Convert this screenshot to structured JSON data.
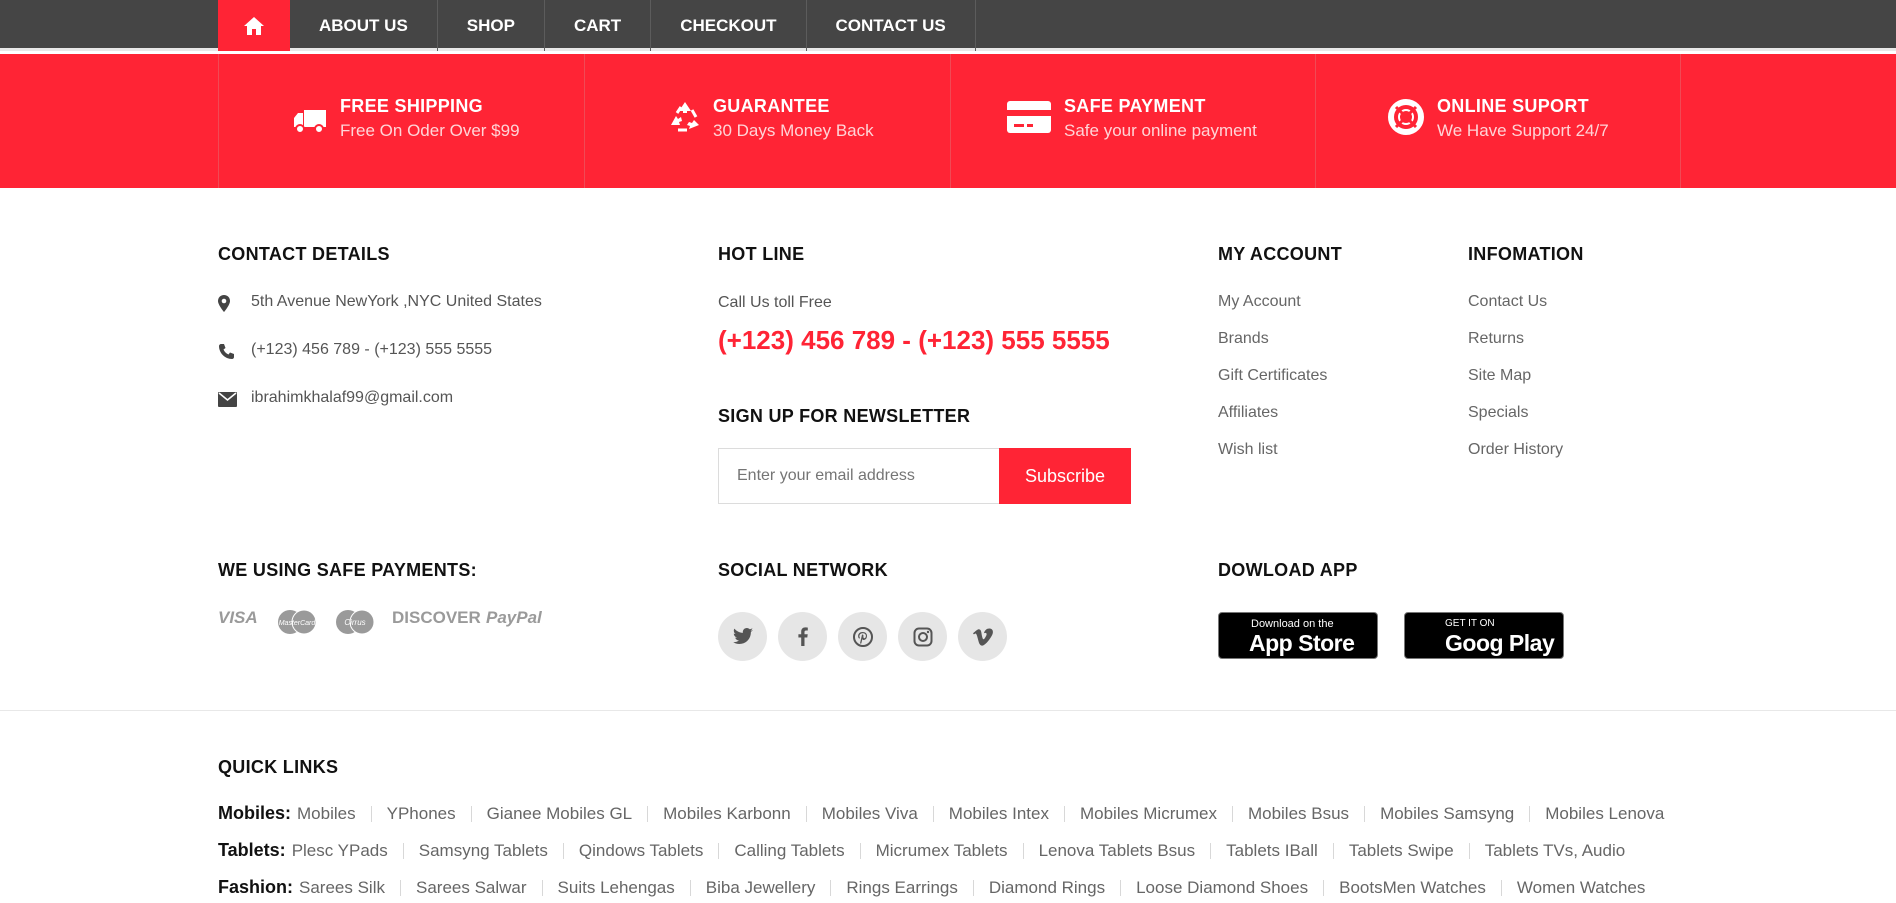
{
  "nav": {
    "items": [
      "ABOUT US",
      "SHOP",
      "CART",
      "CHECKOUT",
      "CONTACT US"
    ]
  },
  "features": [
    {
      "title": "FREE SHIPPING",
      "subtitle": "Free On Oder Over $99",
      "icon": "truck-icon"
    },
    {
      "title": "GUARANTEE",
      "subtitle": "30 Days Money Back",
      "icon": "recycle-icon"
    },
    {
      "title": "SAFE PAYMENT",
      "subtitle": "Safe your online payment",
      "icon": "credit-card-icon"
    },
    {
      "title": "ONLINE SUPORT",
      "subtitle": "We Have Support 24/7",
      "icon": "lifebuoy-icon"
    }
  ],
  "contact": {
    "title": "CONTACT DETAILS",
    "address": "5th Avenue NewYork ,NYC United States",
    "phone": "(+123) 456 789 - (+123) 555 5555",
    "email": "ibrahimkhalaf99@gmail.com"
  },
  "hotline": {
    "title": "HOT LINE",
    "label": "Call Us toll Free",
    "number": "(+123) 456 789 - (+123) 555 5555"
  },
  "newsletter": {
    "title": "SIGN UP FOR NEWSLETTER",
    "placeholder": "Enter your email address",
    "button": "Subscribe"
  },
  "my_account": {
    "title": "MY ACCOUNT",
    "links": [
      "My Account",
      "Brands",
      "Gift Certificates",
      "Affiliates",
      "Wish list"
    ]
  },
  "information": {
    "title": "INFOMATION",
    "links": [
      "Contact Us",
      "Returns",
      "Site Map",
      "Specials",
      "Order History"
    ]
  },
  "payments": {
    "title": "WE USING SAFE PAYMENTS:",
    "methods": [
      "VISA",
      "MasterCard",
      "Cirrus",
      "DISCOVER",
      "PayPal"
    ]
  },
  "social": {
    "title": "SOCIAL NETWORK",
    "icons": [
      "twitter-icon",
      "facebook-icon",
      "pinterest-icon",
      "instagram-icon",
      "vimeo-icon"
    ]
  },
  "app": {
    "title": "DOWLOAD APP",
    "appstore_small": "Download on the",
    "appstore_big": "App Store",
    "gplay_small": "GET IT ON",
    "gplay_big": "Goog Play"
  },
  "quick_links": {
    "title": "QUICK LINKS",
    "rows": [
      {
        "category": "Mobiles:",
        "items": [
          "Mobiles",
          "YPhones",
          "Gianee Mobiles GL",
          "Mobiles Karbonn",
          "Mobiles Viva",
          "Mobiles Intex",
          "Mobiles Micrumex",
          "Mobiles Bsus",
          "Mobiles Samsyng",
          "Mobiles Lenova"
        ]
      },
      {
        "category": "Tablets:",
        "items": [
          "Plesc YPads",
          "Samsyng Tablets",
          "Qindows Tablets",
          "Calling Tablets",
          "Micrumex Tablets",
          "Lenova Tablets Bsus",
          "Tablets IBall",
          "Tablets Swipe",
          "Tablets TVs, Audio"
        ]
      },
      {
        "category": "Fashion:",
        "items": [
          "Sarees Silk",
          "Sarees Salwar",
          "Suits Lehengas",
          "Biba Jewellery",
          "Rings Earrings",
          "Diamond Rings",
          "Loose Diamond Shoes",
          "BootsMen Watches",
          "Women Watches"
        ]
      }
    ]
  }
}
